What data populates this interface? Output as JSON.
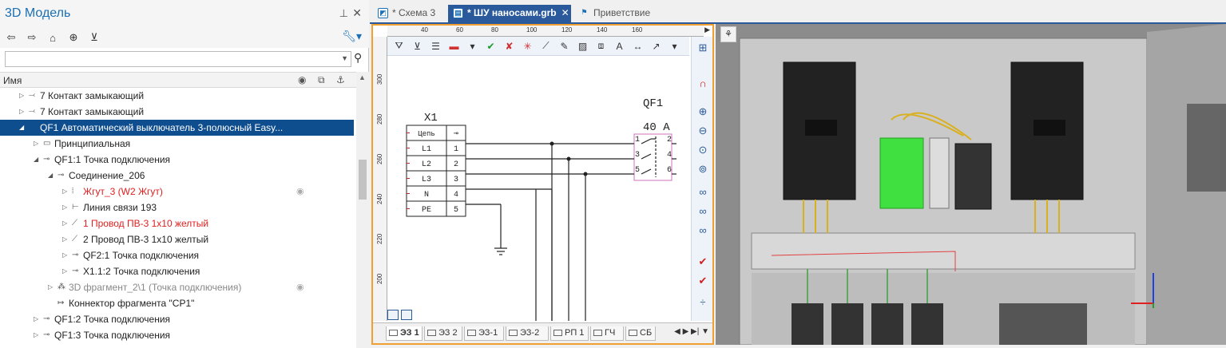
{
  "left_panel": {
    "title": "3D Модель",
    "search_value": "",
    "column_name": "Имя",
    "tree": [
      {
        "label": "7 Контакт замыкающий",
        "indent": 1,
        "twisty": "▷",
        "icon": "⤙",
        "style": "normal"
      },
      {
        "label": "7 Контакт замыкающий",
        "indent": 1,
        "twisty": "▷",
        "icon": "⤙",
        "style": "normal"
      },
      {
        "label": "QF1 Автоматический выключатель 3-полюсный Easy...",
        "indent": 1,
        "twisty": "◢",
        "icon": "",
        "style": "selected"
      },
      {
        "label": "Принципиальная",
        "indent": 2,
        "twisty": "▷",
        "icon": "▭",
        "style": "normal"
      },
      {
        "label": "QF1:1 Точка подключения",
        "indent": 2,
        "twisty": "◢",
        "icon": "⊸",
        "style": "normal"
      },
      {
        "label": "Соединение_206",
        "indent": 3,
        "twisty": "◢",
        "icon": "⊸",
        "style": "normal"
      },
      {
        "label": "Жгут_3 (W2 Жгут)",
        "indent": 4,
        "twisty": "▷",
        "icon": "⦙",
        "style": "red",
        "eye": true
      },
      {
        "label": "Линия связи 193",
        "indent": 4,
        "twisty": "▷",
        "icon": "⊢",
        "style": "normal"
      },
      {
        "label": "1 Провод ПВ-3 1x10 желтый",
        "indent": 4,
        "twisty": "▷",
        "icon": "⟋",
        "style": "red"
      },
      {
        "label": "2 Провод ПВ-3 1x10 желтый",
        "indent": 4,
        "twisty": "▷",
        "icon": "⟋",
        "style": "normal"
      },
      {
        "label": "QF2:1 Точка подключения",
        "indent": 4,
        "twisty": "▷",
        "icon": "⊸",
        "style": "normal"
      },
      {
        "label": "X1.1:2 Точка подключения",
        "indent": 4,
        "twisty": "▷",
        "icon": "⊸",
        "style": "normal"
      },
      {
        "label": "3D фрагмент_2\\1 (Точка подключения)",
        "indent": 3,
        "twisty": "▷",
        "icon": "⁂",
        "style": "gray",
        "eye": true
      },
      {
        "label": "Коннектор фрагмента \"СР1\"",
        "indent": 3,
        "twisty": "",
        "icon": "↦",
        "style": "normal"
      },
      {
        "label": "QF1:2 Точка подключения",
        "indent": 2,
        "twisty": "▷",
        "icon": "⊸",
        "style": "normal"
      },
      {
        "label": "QF1:3 Точка подключения",
        "indent": 2,
        "twisty": "▷",
        "icon": "⊸",
        "style": "normal"
      }
    ]
  },
  "tabs": [
    {
      "label": "* Схема 3",
      "active": false,
      "icon": "schema-icon"
    },
    {
      "label": "* ШУ наносами.grb",
      "active": true,
      "icon": "cabinet-icon",
      "closable": true
    },
    {
      "label": "Приветствие",
      "active": false,
      "icon": "flag-icon"
    }
  ],
  "schematic": {
    "ruler_top": [
      "40",
      "60",
      "80",
      "100",
      "120",
      "140",
      "160"
    ],
    "ruler_left": [
      "300",
      "280",
      "260",
      "240",
      "220",
      "200"
    ],
    "component_x1": "X1",
    "x1_header": [
      "Цепь",
      "⊸"
    ],
    "x1_rows": [
      [
        "L1",
        "1"
      ],
      [
        "L2",
        "2"
      ],
      [
        "L3",
        "3"
      ],
      [
        "N",
        "4"
      ],
      [
        "PE",
        "5"
      ]
    ],
    "component_qf1": "QF1",
    "qf1_rating": "40 А",
    "qf1_pins": [
      "1",
      "2",
      "3",
      "4",
      "5",
      "6"
    ],
    "sheet_tabs": [
      "ЭЗ 1",
      "ЭЗ 2",
      "ЭЗ-1",
      "ЭЗ-2",
      "РП 1",
      "ГЧ",
      "СБ"
    ]
  },
  "colors": {
    "accent": "#2b5a9c",
    "selection": "#0e4d8e",
    "highlight_orange": "#f0a030",
    "error_red": "#e02020",
    "qf1_highlight": "#d070c0"
  }
}
